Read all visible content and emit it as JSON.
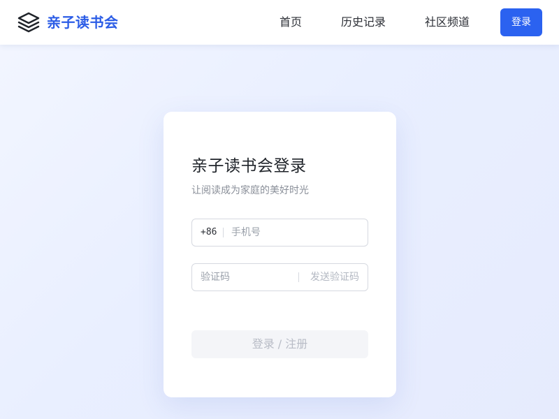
{
  "header": {
    "logo_icon": "stacked-layers-icon",
    "brand_name": "亲子读书会",
    "brand_color": "#2b5ce6",
    "nav": [
      {
        "label": "首页"
      },
      {
        "label": "历史记录"
      },
      {
        "label": "社区频道"
      }
    ],
    "login_label": "登录",
    "login_color": "#2b62f0"
  },
  "login_card": {
    "title": "亲子读书会登录",
    "subtitle": "让阅读成为家庭的美好时光",
    "phone": {
      "prefix": "+86",
      "placeholder": "手机号",
      "value": ""
    },
    "code": {
      "placeholder": "验证码",
      "value": "",
      "send_label": "发送验证码"
    },
    "submit_label": "登录 / 注册"
  }
}
